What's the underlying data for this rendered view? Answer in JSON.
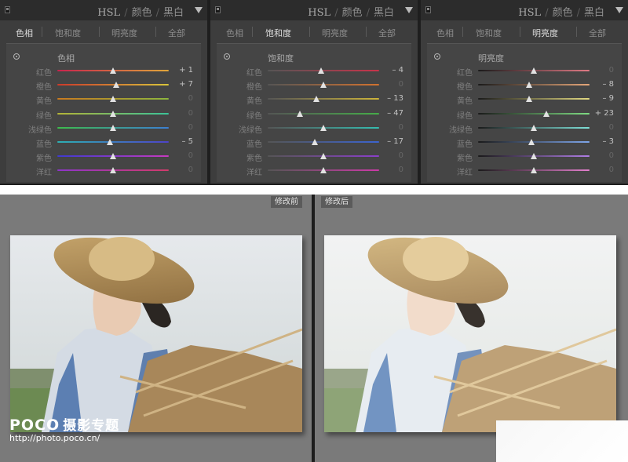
{
  "panels": [
    {
      "title": "HSL",
      "title_colors": "颜色",
      "title_bw": "黑白",
      "tabs": [
        "色相",
        "饱和度",
        "明亮度",
        "全部"
      ],
      "active_tab": 0,
      "group_label": "色相",
      "sliders": [
        {
          "label": "红色",
          "value": "+ 1",
          "pos": 0.5,
          "colors": [
            "#c8234d",
            "#e0a63a"
          ]
        },
        {
          "label": "橙色",
          "value": "+ 7",
          "pos": 0.53,
          "colors": [
            "#cc3a2a",
            "#d9c53a"
          ]
        },
        {
          "label": "黄色",
          "value": "0",
          "pos": 0.5,
          "colors": [
            "#c97a1f",
            "#8db63d"
          ]
        },
        {
          "label": "绿色",
          "value": "0",
          "pos": 0.5,
          "colors": [
            "#b4b437",
            "#3bc398"
          ]
        },
        {
          "label": "浅绿色",
          "value": "0",
          "pos": 0.5,
          "colors": [
            "#3dbb4c",
            "#3c7fd2"
          ]
        },
        {
          "label": "蓝色",
          "value": "– 5",
          "pos": 0.47,
          "colors": [
            "#2db0b3",
            "#4e43c8"
          ]
        },
        {
          "label": "紫色",
          "value": "0",
          "pos": 0.5,
          "colors": [
            "#3e3ad0",
            "#c83ac0"
          ]
        },
        {
          "label": "洋红",
          "value": "0",
          "pos": 0.5,
          "colors": [
            "#8d35c9",
            "#d23b6b"
          ]
        }
      ]
    },
    {
      "title": "HSL",
      "title_colors": "颜色",
      "title_bw": "黑白",
      "tabs": [
        "色相",
        "饱和度",
        "明亮度",
        "全部"
      ],
      "active_tab": 1,
      "group_label": "饱和度",
      "sliders": [
        {
          "label": "红色",
          "value": "– 4",
          "pos": 0.48,
          "colors": [
            "#555555",
            "#c8334a"
          ]
        },
        {
          "label": "橙色",
          "value": "0",
          "pos": 0.5,
          "colors": [
            "#555555",
            "#d2722f"
          ]
        },
        {
          "label": "黄色",
          "value": "– 13",
          "pos": 0.44,
          "colors": [
            "#555555",
            "#cdb43a"
          ]
        },
        {
          "label": "绿色",
          "value": "– 47",
          "pos": 0.29,
          "colors": [
            "#555555",
            "#46ac49"
          ]
        },
        {
          "label": "浅绿色",
          "value": "0",
          "pos": 0.5,
          "colors": [
            "#555555",
            "#35bcb0"
          ]
        },
        {
          "label": "蓝色",
          "value": "– 17",
          "pos": 0.42,
          "colors": [
            "#555555",
            "#3c64cf"
          ]
        },
        {
          "label": "紫色",
          "value": "0",
          "pos": 0.5,
          "colors": [
            "#555555",
            "#8b3fcb"
          ]
        },
        {
          "label": "洋红",
          "value": "0",
          "pos": 0.5,
          "colors": [
            "#555555",
            "#cc3aa7"
          ]
        }
      ]
    },
    {
      "title": "HSL",
      "title_colors": "颜色",
      "title_bw": "黑白",
      "tabs": [
        "色相",
        "饱和度",
        "明亮度",
        "全部"
      ],
      "active_tab": 2,
      "group_label": "明亮度",
      "sliders": [
        {
          "label": "红色",
          "value": "0",
          "pos": 0.5,
          "colors": [
            "#1a1a1a",
            "#e07a85"
          ]
        },
        {
          "label": "橙色",
          "value": "– 8",
          "pos": 0.46,
          "colors": [
            "#1a1a1a",
            "#e6a77a"
          ]
        },
        {
          "label": "黄色",
          "value": "– 9",
          "pos": 0.46,
          "colors": [
            "#1a1a1a",
            "#e2d982"
          ]
        },
        {
          "label": "绿色",
          "value": "+ 23",
          "pos": 0.61,
          "colors": [
            "#1a1a1a",
            "#7fdc83"
          ]
        },
        {
          "label": "浅绿色",
          "value": "0",
          "pos": 0.5,
          "colors": [
            "#1a1a1a",
            "#7fe0d8"
          ]
        },
        {
          "label": "蓝色",
          "value": "– 3",
          "pos": 0.48,
          "colors": [
            "#1a1a1a",
            "#7fa6ea"
          ]
        },
        {
          "label": "紫色",
          "value": "0",
          "pos": 0.5,
          "colors": [
            "#1a1a1a",
            "#b07ee6"
          ]
        },
        {
          "label": "洋红",
          "value": "0",
          "pos": 0.5,
          "colors": [
            "#1a1a1a",
            "#e37fcd"
          ]
        }
      ]
    }
  ],
  "compare": {
    "before_label": "修改前",
    "after_label": "修改后"
  },
  "watermark": {
    "logo": "POCO",
    "logo_cn": "摄影专题",
    "url": "http://photo.poco.cn/"
  }
}
